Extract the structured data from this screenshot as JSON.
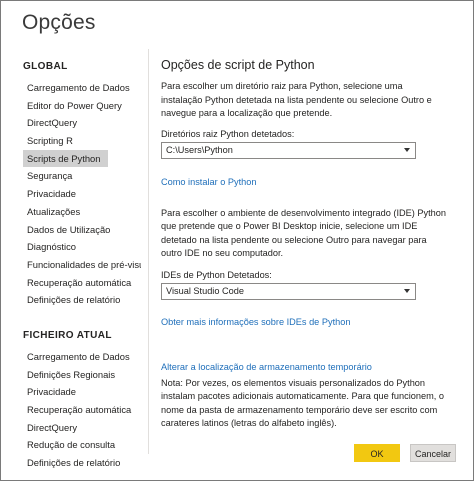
{
  "window": {
    "title": "Opções"
  },
  "nav": {
    "global_heading": "GLOBAL",
    "global_items": [
      "Carregamento de Dados",
      "Editor do Power Query",
      "DirectQuery",
      "Scripting R",
      "Scripts de Python",
      "Segurança",
      "Privacidade",
      "Atualizações",
      "Dados de Utilização",
      "Diagnóstico",
      "Funcionalidades de pré-visu...",
      "Recuperação automática",
      "Definições de relatório"
    ],
    "global_selected_index": 4,
    "file_heading": "FICHEIRO ATUAL",
    "file_items": [
      "Carregamento de Dados",
      "Definições Regionais",
      "Privacidade",
      "Recuperação automática",
      "DirectQuery",
      "Redução de consulta",
      "Definições de relatório"
    ]
  },
  "content": {
    "title": "Opções de script de Python",
    "intro": "Para escolher um diretório raiz para Python, selecione uma instalação Python detetada na lista pendente ou selecione Outro e navegue para a localização que pretende.",
    "root_label": "Diretórios raiz Python detetados:",
    "root_value": "C:\\Users\\Python",
    "install_link": "Como instalar o Python",
    "ide_intro": "Para escolher o ambiente de desenvolvimento integrado (IDE) Python que pretende que o Power BI Desktop inicie, selecione um IDE detetado na lista pendente ou selecione Outro para navegar para outro IDE no seu computador.",
    "ide_label": "IDEs de Python Detetados:",
    "ide_value": "Visual Studio Code",
    "ide_link": "Obter mais informações sobre IDEs de Python",
    "storage_link": "Alterar a localização de armazenamento temporário",
    "note": "Nota: Por vezes, os elementos visuais personalizados do Python instalam pacotes adicionais automaticamente. Para que funcionem, o nome da pasta de armazenamento temporário deve ser escrito com carateres latinos (letras do alfabeto inglês)."
  },
  "buttons": {
    "ok": "OK",
    "cancel": "Cancelar"
  },
  "colors": {
    "accent": "#f2c811",
    "link": "#1f6fba",
    "selected_bg": "#d0d0d0"
  }
}
